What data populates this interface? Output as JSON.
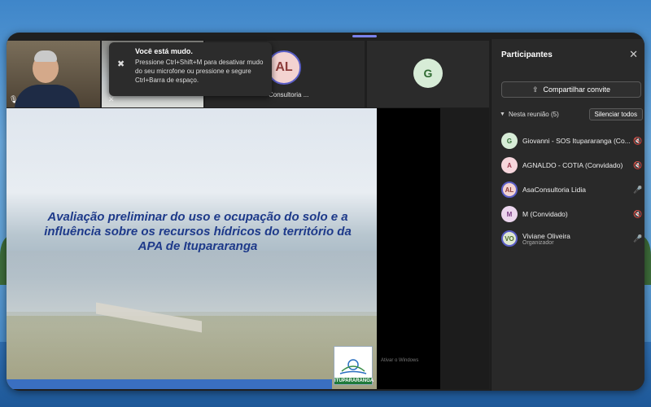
{
  "toast": {
    "title": "Você está mudo.",
    "body": "Pressione Ctrl+Shift+M para desativar mudo do seu microfone ou pressione e segure Ctrl+Barra de espaço."
  },
  "video_tiles": {
    "tile_3_initials": "AL",
    "tile_3_name": "Consultoria ...",
    "tile_4_initials": "G"
  },
  "slide": {
    "title": "Avaliação preliminar do uso e ocupação do solo e a influência sobre os recursos hídricos do território da APA de Itupararanga",
    "logo_text": "ITUPARARANGA"
  },
  "overlay": {
    "activate_windows": "Ativar o Windows"
  },
  "participants_pane": {
    "title": "Participantes",
    "share_button": "Compartilhar convite",
    "section_label": "Nesta reunião (5)",
    "mute_all_button": "Silenciar todos",
    "participants": [
      {
        "initials": "G",
        "name": "Giovanni - SOS Itupararanga (Co...",
        "role": "",
        "mic": "muted",
        "avatar_bg": "#d7ecd7",
        "avatar_fg": "#2f6b32"
      },
      {
        "initials": "A",
        "name": "AGNALDO - COTIA (Convidado)",
        "role": "",
        "mic": "muted",
        "avatar_bg": "#f6d6dc",
        "avatar_fg": "#9b3b4e"
      },
      {
        "initials": "AL",
        "name": "AsaConsultoria Lidia",
        "role": "",
        "mic": "on",
        "avatar_bg": "#f3d3d1",
        "avatar_fg": "#8c3c3a"
      },
      {
        "initials": "M",
        "name": "M (Convidado)",
        "role": "",
        "mic": "muted",
        "avatar_bg": "#ecd6ee",
        "avatar_fg": "#7b3c84"
      },
      {
        "initials": "VO",
        "name": "Viviane Oliveira",
        "role": "Organizador",
        "mic": "on",
        "avatar_bg": "#dfe8d2",
        "avatar_fg": "#4b6b2b"
      }
    ]
  },
  "colors": {
    "accent": "#5b5fc7",
    "slide_title": "#1e3a8a",
    "pane_bg": "#292929"
  }
}
